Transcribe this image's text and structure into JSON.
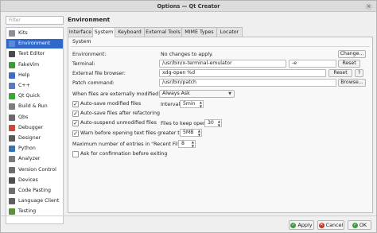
{
  "window": {
    "title": "Options — Qt Creator",
    "close_icon": "×"
  },
  "sidebar": {
    "filter_placeholder": "Filter",
    "items": [
      {
        "label": "Kits",
        "color": "#8a8f99"
      },
      {
        "label": "Environment",
        "color": "#5b8bd6"
      },
      {
        "label": "Text Editor",
        "color": "#4b4b4b"
      },
      {
        "label": "FakeVim",
        "color": "#3b9b3b"
      },
      {
        "label": "Help",
        "color": "#3d6fc0"
      },
      {
        "label": "C++",
        "color": "#5a7bb5"
      },
      {
        "label": "Qt Quick",
        "color": "#41a336"
      },
      {
        "label": "Build & Run",
        "color": "#7d7d7d"
      },
      {
        "label": "Qbs",
        "color": "#6a6a6a"
      },
      {
        "label": "Debugger",
        "color": "#c24d3a"
      },
      {
        "label": "Designer",
        "color": "#5a5a5a"
      },
      {
        "label": "Python",
        "color": "#3b72b0"
      },
      {
        "label": "Analyzer",
        "color": "#7a7a7a"
      },
      {
        "label": "Version Control",
        "color": "#6d6d6d"
      },
      {
        "label": "Devices",
        "color": "#4f4f4f"
      },
      {
        "label": "Code Pasting",
        "color": "#6e6e6e"
      },
      {
        "label": "Language Client",
        "color": "#5f5f5f"
      },
      {
        "label": "Testing",
        "color": "#5c8f3e"
      }
    ]
  },
  "panel": {
    "title": "Environment"
  },
  "tabs": [
    "Interface",
    "System",
    "Keyboard",
    "External Tools",
    "MIME Types",
    "Locator"
  ],
  "system": {
    "group_title": "System",
    "environment_label": "Environment:",
    "environment_value": "No changes to apply.",
    "change_button": "Change...",
    "terminal_label": "Terminal:",
    "terminal_value": "/usr/bin/x-terminal-emulator",
    "terminal_args": "-e",
    "reset_button": "Reset",
    "file_browser_label": "External file browser:",
    "file_browser_value": "xdg-open %d",
    "help_button": "?",
    "patch_label": "Patch command:",
    "patch_value": "/usr/bin/patch",
    "browse_button": "Browse...",
    "files_modified_label": "When files are externally modified:",
    "files_modified_value": "Always Ask",
    "autosave_label": "Auto-save modified files",
    "interval_label": "Interval:",
    "interval_value": "5min",
    "autosave_refactor_label": "Auto-save files after refactoring",
    "autosuspend_label": "Auto-suspend unmodified files",
    "files_to_keep_label": "Files to keep open:",
    "files_to_keep_value": "30",
    "warn_large_label": "Warn before opening text files greater than",
    "warn_large_value": "5MB",
    "recent_files_label": "Maximum number of entries in \"Recent Files\":",
    "recent_files_value": "8",
    "ask_exit_label": "Ask for confirmation before exiting",
    "check_mark": "✓"
  },
  "footer": {
    "apply": "Apply",
    "cancel": "Cancel",
    "ok": "OK"
  }
}
